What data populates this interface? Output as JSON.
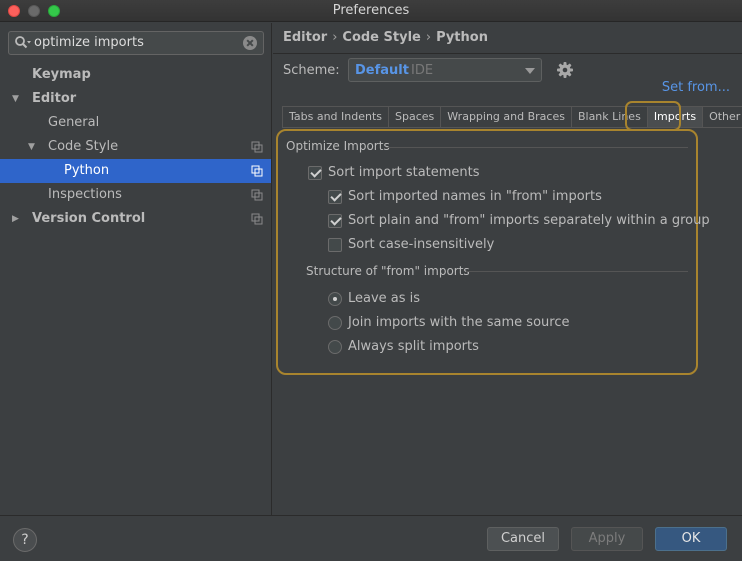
{
  "window": {
    "title": "Preferences"
  },
  "search": {
    "value": "optimize imports"
  },
  "tree": [
    {
      "label": "Keymap",
      "bold": true,
      "indent": 0,
      "arrow": "",
      "copy": false,
      "selected": false
    },
    {
      "label": "Editor",
      "bold": true,
      "indent": 0,
      "arrow": "▼",
      "copy": false,
      "selected": false
    },
    {
      "label": "General",
      "bold": false,
      "indent": 1,
      "arrow": "",
      "copy": false,
      "selected": false
    },
    {
      "label": "Code Style",
      "bold": false,
      "indent": 1,
      "arrow": "▼",
      "copy": true,
      "selected": false
    },
    {
      "label": "Python",
      "bold": false,
      "indent": 2,
      "arrow": "",
      "copy": true,
      "selected": true
    },
    {
      "label": "Inspections",
      "bold": false,
      "indent": 1,
      "arrow": "",
      "copy": true,
      "selected": false
    },
    {
      "label": "Version Control",
      "bold": true,
      "indent": 0,
      "arrow": "▶",
      "copy": true,
      "selected": false
    }
  ],
  "breadcrumb": {
    "part1": "Editor",
    "part2": "Code Style",
    "part3": "Python",
    "separator": "›"
  },
  "scheme": {
    "label": "Scheme:",
    "value": "Default",
    "type": "IDE",
    "set_from": "Set from..."
  },
  "tabs": [
    {
      "label": "Tabs and Indents",
      "active": false
    },
    {
      "label": "Spaces",
      "active": false
    },
    {
      "label": "Wrapping and Braces",
      "active": false
    },
    {
      "label": "Blank Lines",
      "active": false
    },
    {
      "label": "Imports",
      "active": true
    },
    {
      "label": "Other",
      "active": false
    }
  ],
  "optimize": {
    "title": "Optimize Imports",
    "sort_statements": {
      "label": "Sort import statements",
      "checked": true
    },
    "sort_names": {
      "label": "Sort imported names in \"from\" imports",
      "checked": true
    },
    "sort_plain": {
      "label": "Sort plain and \"from\" imports separately within a group",
      "checked": true
    },
    "case_insensitive": {
      "label": "Sort case-insensitively",
      "checked": false
    }
  },
  "structure": {
    "title": "Structure of \"from\" imports",
    "leave": {
      "label": "Leave as is",
      "selected": true
    },
    "join": {
      "label": "Join imports with the same source",
      "selected": false
    },
    "split": {
      "label": "Always split imports",
      "selected": false
    }
  },
  "footer": {
    "help": "?",
    "cancel": "Cancel",
    "apply": "Apply",
    "ok": "OK"
  },
  "colors": {
    "accent": "#2f65ca",
    "highlight": "#a8842e",
    "link": "#5895e6"
  }
}
